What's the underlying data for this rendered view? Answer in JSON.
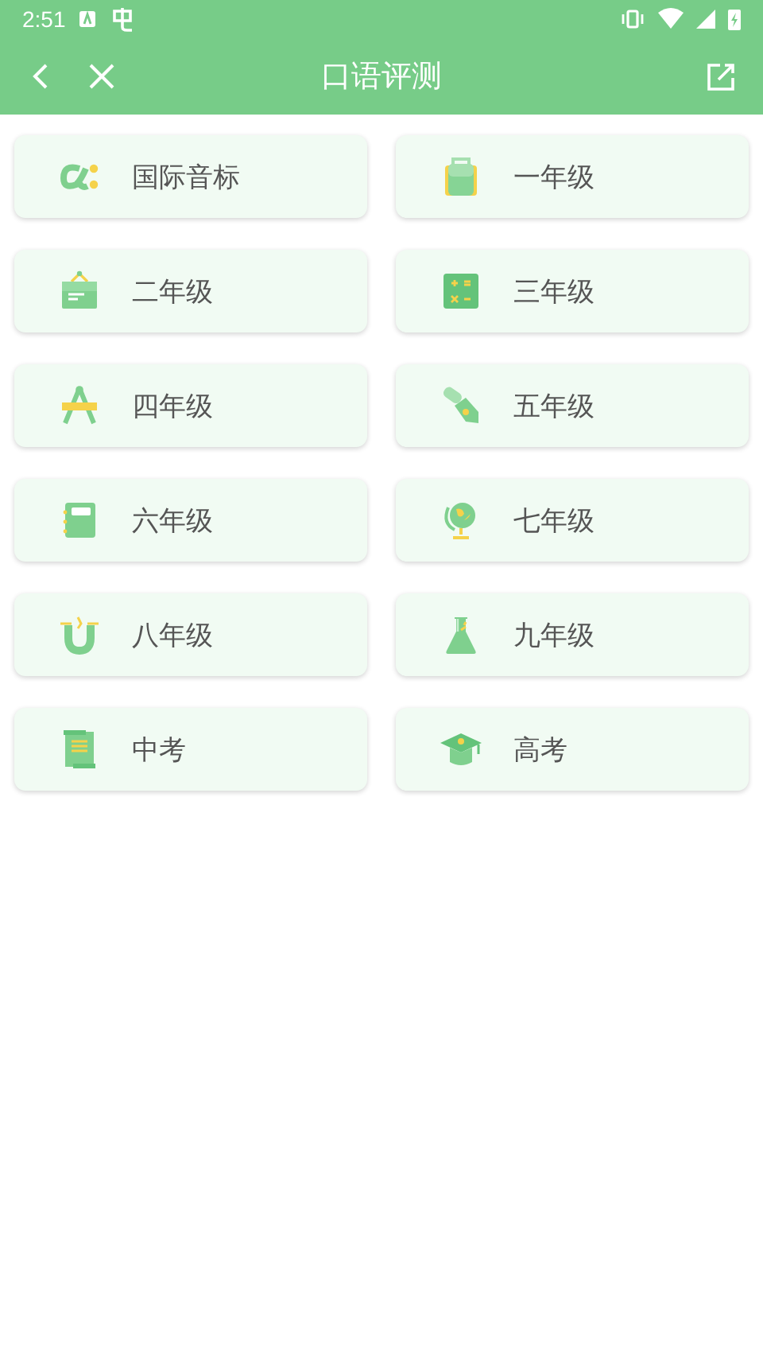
{
  "status_bar": {
    "time": "2:51"
  },
  "toolbar": {
    "title": "口语评测"
  },
  "items": [
    {
      "label": "国际音标",
      "kind": "alpha"
    },
    {
      "label": "一年级",
      "kind": "bag"
    },
    {
      "label": "二年级",
      "kind": "board"
    },
    {
      "label": "三年级",
      "kind": "calc"
    },
    {
      "label": "四年级",
      "kind": "compass"
    },
    {
      "label": "五年级",
      "kind": "pen"
    },
    {
      "label": "六年级",
      "kind": "notebook"
    },
    {
      "label": "七年级",
      "kind": "globe"
    },
    {
      "label": "八年级",
      "kind": "magnet"
    },
    {
      "label": "九年级",
      "kind": "flask"
    },
    {
      "label": "中考",
      "kind": "scroll"
    },
    {
      "label": "高考",
      "kind": "cap"
    }
  ]
}
